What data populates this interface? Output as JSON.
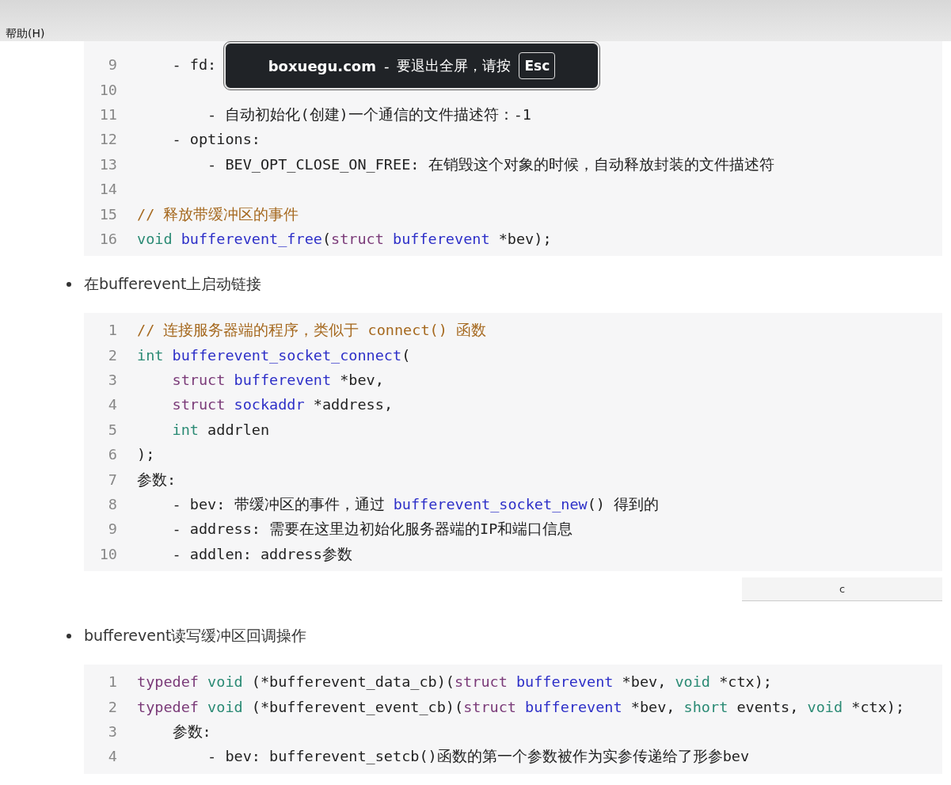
{
  "menu": {
    "items": [
      "帮助(H)"
    ]
  },
  "fullscreen_notice": {
    "site": "boxuegu.com",
    "separator": "-",
    "message": "要退出全屏，请按",
    "key": "Esc"
  },
  "document": [
    {
      "kind": "code",
      "lines": [
        {
          "number": "9",
          "tokens": [
            {
              "kind": "tx",
              "t": "    - fd:"
            }
          ]
        },
        {
          "number": "10"
        },
        {
          "number": "11",
          "tokens": [
            {
              "kind": "tx",
              "t": "        - 自动初始化(创建)一个通信的文件描述符：-1"
            }
          ]
        },
        {
          "number": "12",
          "tokens": [
            {
              "kind": "tx",
              "t": "    - options:"
            }
          ]
        },
        {
          "number": "13",
          "tokens": [
            {
              "kind": "tx",
              "t": "        - BEV_OPT_CLOSE_ON_FREE: 在销毁这个对象的时候，自动释放封装的文件描述符"
            }
          ]
        },
        {
          "number": "14"
        },
        {
          "number": "15",
          "tokens": [
            {
              "kind": "cm",
              "t": "// 释放带缓冲区的事件"
            }
          ]
        },
        {
          "number": "16",
          "tokens": [
            {
              "kind": "kw",
              "t": "void "
            },
            {
              "kind": "fn",
              "t": "bufferevent_free"
            },
            {
              "kind": "tx",
              "t": "("
            },
            {
              "kind": "st",
              "t": "struct "
            },
            {
              "kind": "fn",
              "t": "bufferevent"
            },
            {
              "kind": "tx",
              "t": " *bev);"
            }
          ]
        }
      ]
    },
    {
      "kind": "bullet",
      "text": "在bufferevent上启动链接"
    },
    {
      "kind": "code",
      "lines": [
        {
          "number": "1",
          "tokens": [
            {
              "kind": "cm",
              "t": "// 连接服务器端的程序，类似于 connect() 函数"
            }
          ]
        },
        {
          "number": "2",
          "tokens": [
            {
              "kind": "kw",
              "t": "int "
            },
            {
              "kind": "fn",
              "t": "bufferevent_socket_connect"
            },
            {
              "kind": "tx",
              "t": "("
            }
          ]
        },
        {
          "number": "3",
          "tokens": [
            {
              "kind": "st",
              "t": "    struct "
            },
            {
              "kind": "fn",
              "t": "bufferevent"
            },
            {
              "kind": "tx",
              "t": " *bev,"
            }
          ]
        },
        {
          "number": "4",
          "tokens": [
            {
              "kind": "st",
              "t": "    struct "
            },
            {
              "kind": "fn",
              "t": "sockaddr"
            },
            {
              "kind": "tx",
              "t": " *address,"
            }
          ]
        },
        {
          "number": "5",
          "tokens": [
            {
              "kind": "kw",
              "t": "    int"
            },
            {
              "kind": "tx",
              "t": " addrlen"
            }
          ]
        },
        {
          "number": "6",
          "tokens": [
            {
              "kind": "tx",
              "t": ");"
            }
          ]
        },
        {
          "number": "7",
          "tokens": [
            {
              "kind": "tx",
              "t": "参数:"
            }
          ]
        },
        {
          "number": "8",
          "tokens": [
            {
              "kind": "tx",
              "t": "    - bev: 带缓冲区的事件，通过 "
            },
            {
              "kind": "fn",
              "t": "bufferevent_socket_new"
            },
            {
              "kind": "tx",
              "t": "() 得到的"
            }
          ]
        },
        {
          "number": "9",
          "tokens": [
            {
              "kind": "tx",
              "t": "    - address: 需要在这里边初始化服务器端的IP和端口信息"
            }
          ]
        },
        {
          "number": "10",
          "tokens": [
            {
              "kind": "tx",
              "t": "    - addlen: address参数"
            }
          ]
        }
      ]
    },
    {
      "kind": "button",
      "text": "c"
    },
    {
      "kind": "bullet",
      "text": "bufferevent读写缓冲区回调操作"
    },
    {
      "kind": "code",
      "lines": [
        {
          "number": "1",
          "tokens": [
            {
              "kind": "st",
              "t": "typedef "
            },
            {
              "kind": "kw",
              "t": "void"
            },
            {
              "kind": "tx",
              "t": " (*bufferevent_data_cb)("
            },
            {
              "kind": "st",
              "t": "struct "
            },
            {
              "kind": "fn",
              "t": "bufferevent"
            },
            {
              "kind": "tx",
              "t": " *bev, "
            },
            {
              "kind": "kw",
              "t": "void"
            },
            {
              "kind": "tx",
              "t": " *ctx);"
            }
          ]
        },
        {
          "number": "2",
          "tokens": [
            {
              "kind": "st",
              "t": "typedef "
            },
            {
              "kind": "kw",
              "t": "void"
            },
            {
              "kind": "tx",
              "t": " (*bufferevent_event_cb)("
            },
            {
              "kind": "st",
              "t": "struct "
            },
            {
              "kind": "fn",
              "t": "bufferevent"
            },
            {
              "kind": "tx",
              "t": " *bev, "
            },
            {
              "kind": "kw",
              "t": "short"
            },
            {
              "kind": "tx",
              "t": " events, "
            },
            {
              "kind": "kw",
              "t": "void"
            },
            {
              "kind": "tx",
              "t": " *ctx);"
            }
          ]
        },
        {
          "number": "3",
          "tokens": [
            {
              "kind": "tx",
              "t": "    参数:"
            }
          ]
        },
        {
          "number": "4",
          "tokens": [
            {
              "kind": "tx",
              "t": "        - bev: bufferevent_setcb()函数的第一个参数被作为实参传递给了形参bev"
            }
          ]
        }
      ]
    }
  ]
}
